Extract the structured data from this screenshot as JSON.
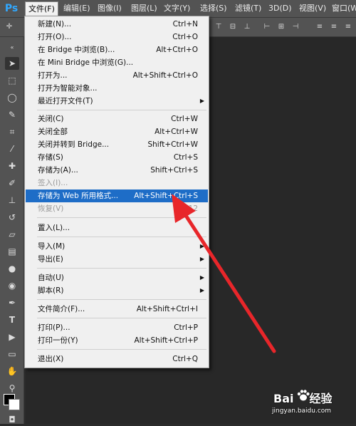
{
  "app": {
    "logo": "Ps"
  },
  "menubar": {
    "items": [
      "文件(F)",
      "编辑(E)",
      "图像(I)",
      "图层(L)",
      "文字(Y)",
      "选择(S)",
      "滤镜(T)",
      "3D(D)",
      "视图(V)",
      "窗口(W)"
    ]
  },
  "file_menu": {
    "items": [
      {
        "label": "新建(N)...",
        "shortcut": "Ctrl+N"
      },
      {
        "label": "打开(O)...",
        "shortcut": "Ctrl+O"
      },
      {
        "label": "在 Bridge 中浏览(B)...",
        "shortcut": "Alt+Ctrl+O"
      },
      {
        "label": "在 Mini Bridge 中浏览(G)...",
        "shortcut": ""
      },
      {
        "label": "打开为...",
        "shortcut": "Alt+Shift+Ctrl+O"
      },
      {
        "label": "打开为智能对象...",
        "shortcut": ""
      },
      {
        "label": "最近打开文件(T)",
        "shortcut": ""
      },
      {
        "label": "关闭(C)",
        "shortcut": "Ctrl+W"
      },
      {
        "label": "关闭全部",
        "shortcut": "Alt+Ctrl+W"
      },
      {
        "label": "关闭并转到 Bridge...",
        "shortcut": "Shift+Ctrl+W"
      },
      {
        "label": "存储(S)",
        "shortcut": "Ctrl+S"
      },
      {
        "label": "存储为(A)...",
        "shortcut": "Shift+Ctrl+S"
      },
      {
        "label": "签入(I)...",
        "shortcut": ""
      },
      {
        "label": "存储为 Web 所用格式...",
        "shortcut": "Alt+Shift+Ctrl+S"
      },
      {
        "label": "恢复(V)",
        "shortcut": "F12"
      },
      {
        "label": "置入(L)...",
        "shortcut": ""
      },
      {
        "label": "导入(M)",
        "shortcut": ""
      },
      {
        "label": "导出(E)",
        "shortcut": ""
      },
      {
        "label": "自动(U)",
        "shortcut": ""
      },
      {
        "label": "脚本(R)",
        "shortcut": ""
      },
      {
        "label": "文件简介(F)...",
        "shortcut": "Alt+Shift+Ctrl+I"
      },
      {
        "label": "打印(P)...",
        "shortcut": "Ctrl+P"
      },
      {
        "label": "打印一份(Y)",
        "shortcut": "Alt+Shift+Ctrl+P"
      },
      {
        "label": "退出(X)",
        "shortcut": "Ctrl+Q"
      }
    ]
  },
  "watermark": {
    "brand_left": "Bai",
    "brand_right": "经验",
    "url": "jingyan.baidu.com"
  },
  "colors": {
    "highlight": "#1e6dc7",
    "arrow": "#e8262a",
    "ui_panel": "#535353"
  }
}
